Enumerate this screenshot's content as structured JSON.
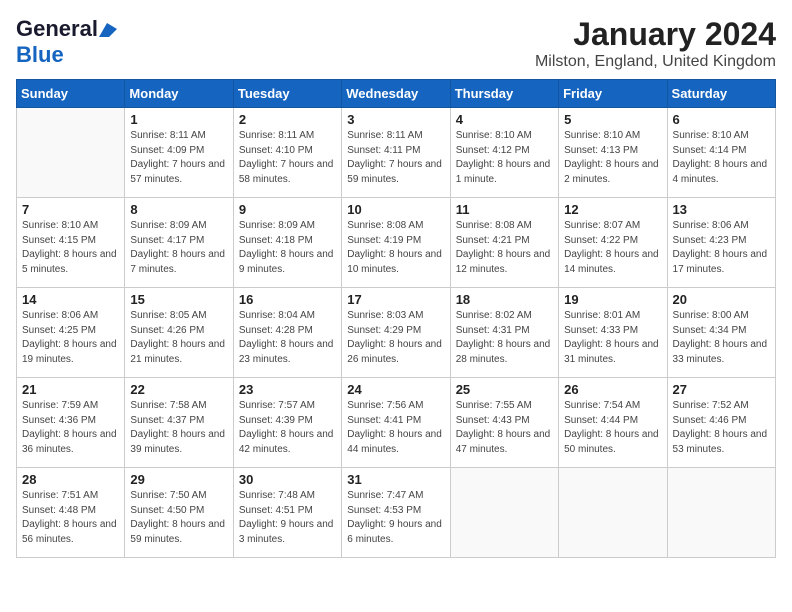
{
  "logo": {
    "general": "General",
    "blue": "Blue"
  },
  "header": {
    "month": "January 2024",
    "location": "Milston, England, United Kingdom"
  },
  "weekdays": [
    "Sunday",
    "Monday",
    "Tuesday",
    "Wednesday",
    "Thursday",
    "Friday",
    "Saturday"
  ],
  "weeks": [
    [
      {
        "day": "",
        "sunrise": "",
        "sunset": "",
        "daylight": ""
      },
      {
        "day": "1",
        "sunrise": "Sunrise: 8:11 AM",
        "sunset": "Sunset: 4:09 PM",
        "daylight": "Daylight: 7 hours and 57 minutes."
      },
      {
        "day": "2",
        "sunrise": "Sunrise: 8:11 AM",
        "sunset": "Sunset: 4:10 PM",
        "daylight": "Daylight: 7 hours and 58 minutes."
      },
      {
        "day": "3",
        "sunrise": "Sunrise: 8:11 AM",
        "sunset": "Sunset: 4:11 PM",
        "daylight": "Daylight: 7 hours and 59 minutes."
      },
      {
        "day": "4",
        "sunrise": "Sunrise: 8:10 AM",
        "sunset": "Sunset: 4:12 PM",
        "daylight": "Daylight: 8 hours and 1 minute."
      },
      {
        "day": "5",
        "sunrise": "Sunrise: 8:10 AM",
        "sunset": "Sunset: 4:13 PM",
        "daylight": "Daylight: 8 hours and 2 minutes."
      },
      {
        "day": "6",
        "sunrise": "Sunrise: 8:10 AM",
        "sunset": "Sunset: 4:14 PM",
        "daylight": "Daylight: 8 hours and 4 minutes."
      }
    ],
    [
      {
        "day": "7",
        "sunrise": "Sunrise: 8:10 AM",
        "sunset": "Sunset: 4:15 PM",
        "daylight": "Daylight: 8 hours and 5 minutes."
      },
      {
        "day": "8",
        "sunrise": "Sunrise: 8:09 AM",
        "sunset": "Sunset: 4:17 PM",
        "daylight": "Daylight: 8 hours and 7 minutes."
      },
      {
        "day": "9",
        "sunrise": "Sunrise: 8:09 AM",
        "sunset": "Sunset: 4:18 PM",
        "daylight": "Daylight: 8 hours and 9 minutes."
      },
      {
        "day": "10",
        "sunrise": "Sunrise: 8:08 AM",
        "sunset": "Sunset: 4:19 PM",
        "daylight": "Daylight: 8 hours and 10 minutes."
      },
      {
        "day": "11",
        "sunrise": "Sunrise: 8:08 AM",
        "sunset": "Sunset: 4:21 PM",
        "daylight": "Daylight: 8 hours and 12 minutes."
      },
      {
        "day": "12",
        "sunrise": "Sunrise: 8:07 AM",
        "sunset": "Sunset: 4:22 PM",
        "daylight": "Daylight: 8 hours and 14 minutes."
      },
      {
        "day": "13",
        "sunrise": "Sunrise: 8:06 AM",
        "sunset": "Sunset: 4:23 PM",
        "daylight": "Daylight: 8 hours and 17 minutes."
      }
    ],
    [
      {
        "day": "14",
        "sunrise": "Sunrise: 8:06 AM",
        "sunset": "Sunset: 4:25 PM",
        "daylight": "Daylight: 8 hours and 19 minutes."
      },
      {
        "day": "15",
        "sunrise": "Sunrise: 8:05 AM",
        "sunset": "Sunset: 4:26 PM",
        "daylight": "Daylight: 8 hours and 21 minutes."
      },
      {
        "day": "16",
        "sunrise": "Sunrise: 8:04 AM",
        "sunset": "Sunset: 4:28 PM",
        "daylight": "Daylight: 8 hours and 23 minutes."
      },
      {
        "day": "17",
        "sunrise": "Sunrise: 8:03 AM",
        "sunset": "Sunset: 4:29 PM",
        "daylight": "Daylight: 8 hours and 26 minutes."
      },
      {
        "day": "18",
        "sunrise": "Sunrise: 8:02 AM",
        "sunset": "Sunset: 4:31 PM",
        "daylight": "Daylight: 8 hours and 28 minutes."
      },
      {
        "day": "19",
        "sunrise": "Sunrise: 8:01 AM",
        "sunset": "Sunset: 4:33 PM",
        "daylight": "Daylight: 8 hours and 31 minutes."
      },
      {
        "day": "20",
        "sunrise": "Sunrise: 8:00 AM",
        "sunset": "Sunset: 4:34 PM",
        "daylight": "Daylight: 8 hours and 33 minutes."
      }
    ],
    [
      {
        "day": "21",
        "sunrise": "Sunrise: 7:59 AM",
        "sunset": "Sunset: 4:36 PM",
        "daylight": "Daylight: 8 hours and 36 minutes."
      },
      {
        "day": "22",
        "sunrise": "Sunrise: 7:58 AM",
        "sunset": "Sunset: 4:37 PM",
        "daylight": "Daylight: 8 hours and 39 minutes."
      },
      {
        "day": "23",
        "sunrise": "Sunrise: 7:57 AM",
        "sunset": "Sunset: 4:39 PM",
        "daylight": "Daylight: 8 hours and 42 minutes."
      },
      {
        "day": "24",
        "sunrise": "Sunrise: 7:56 AM",
        "sunset": "Sunset: 4:41 PM",
        "daylight": "Daylight: 8 hours and 44 minutes."
      },
      {
        "day": "25",
        "sunrise": "Sunrise: 7:55 AM",
        "sunset": "Sunset: 4:43 PM",
        "daylight": "Daylight: 8 hours and 47 minutes."
      },
      {
        "day": "26",
        "sunrise": "Sunrise: 7:54 AM",
        "sunset": "Sunset: 4:44 PM",
        "daylight": "Daylight: 8 hours and 50 minutes."
      },
      {
        "day": "27",
        "sunrise": "Sunrise: 7:52 AM",
        "sunset": "Sunset: 4:46 PM",
        "daylight": "Daylight: 8 hours and 53 minutes."
      }
    ],
    [
      {
        "day": "28",
        "sunrise": "Sunrise: 7:51 AM",
        "sunset": "Sunset: 4:48 PM",
        "daylight": "Daylight: 8 hours and 56 minutes."
      },
      {
        "day": "29",
        "sunrise": "Sunrise: 7:50 AM",
        "sunset": "Sunset: 4:50 PM",
        "daylight": "Daylight: 8 hours and 59 minutes."
      },
      {
        "day": "30",
        "sunrise": "Sunrise: 7:48 AM",
        "sunset": "Sunset: 4:51 PM",
        "daylight": "Daylight: 9 hours and 3 minutes."
      },
      {
        "day": "31",
        "sunrise": "Sunrise: 7:47 AM",
        "sunset": "Sunset: 4:53 PM",
        "daylight": "Daylight: 9 hours and 6 minutes."
      },
      {
        "day": "",
        "sunrise": "",
        "sunset": "",
        "daylight": ""
      },
      {
        "day": "",
        "sunrise": "",
        "sunset": "",
        "daylight": ""
      },
      {
        "day": "",
        "sunrise": "",
        "sunset": "",
        "daylight": ""
      }
    ]
  ]
}
